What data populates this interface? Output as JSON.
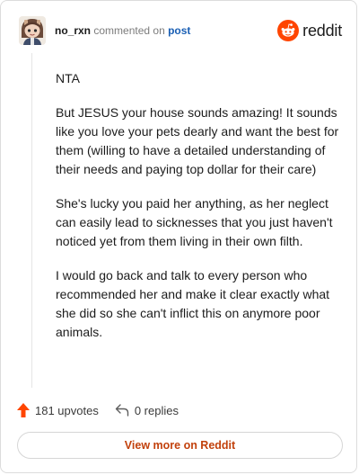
{
  "header": {
    "username": "no_rxn",
    "commented_on": "commented on",
    "post_link": "post",
    "brand_name": "reddit",
    "brand_color": "#ff4500",
    "avatar_icon": "user-avatar-icon"
  },
  "comment": {
    "paragraphs": [
      "NTA",
      "But JESUS your house sounds amazing! It sounds like you love your pets dearly and want the best for them (willing to have a detailed understanding of their needs and paying top dollar for their care)",
      "She's lucky you paid her anything, as her neglect can easily lead to sicknesses that you just haven't noticed yet from them living in their own filth.",
      "I would go back and talk to every person who recommended her and make it clear exactly what she did so she can't inflict this on anymore poor animals."
    ]
  },
  "footer": {
    "upvotes_label": "181 upvotes",
    "replies_label": "0 replies",
    "upvote_icon": "upvote-arrow-icon",
    "reply_icon": "reply-arrow-icon",
    "upvote_color": "#ff4500"
  },
  "view_more": {
    "label": "View more on Reddit",
    "color": "#c2410c"
  }
}
